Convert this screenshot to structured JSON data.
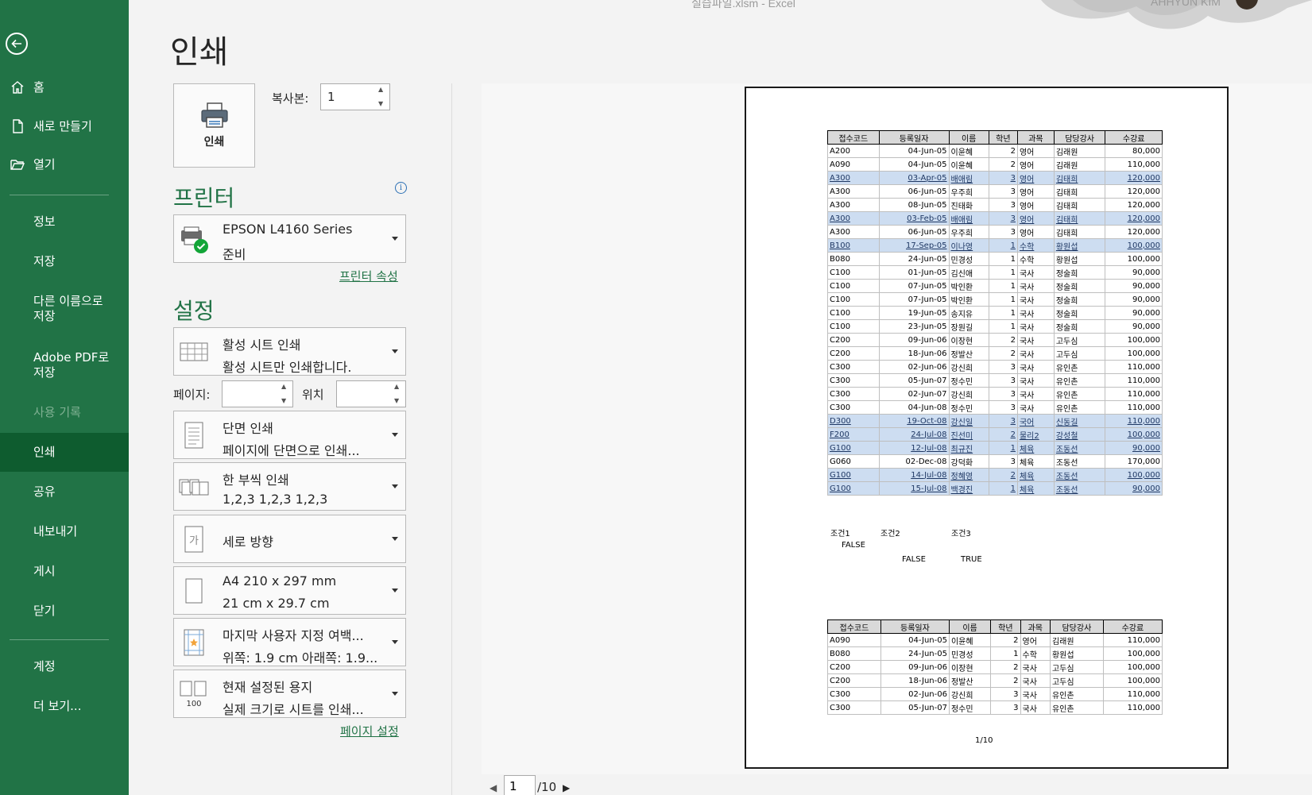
{
  "window": {
    "title": "실습파일.xlsm  -  Excel",
    "user": "AHHYUN KIM"
  },
  "sidebar": {
    "items": [
      {
        "label": "홈",
        "icon": "home-icon"
      },
      {
        "label": "새로 만들기",
        "icon": "new-document-icon"
      },
      {
        "label": "열기",
        "icon": "folder-open-icon"
      },
      {
        "label": "정보"
      },
      {
        "label": "저장"
      },
      {
        "label": "다른 이름으로\n저장"
      },
      {
        "label": "Adobe PDF로\n저장"
      },
      {
        "label": "사용 기록"
      },
      {
        "label": "인쇄"
      },
      {
        "label": "공유"
      },
      {
        "label": "내보내기"
      },
      {
        "label": "게시"
      },
      {
        "label": "닫기"
      },
      {
        "label": "계정"
      },
      {
        "label": "더 보기..."
      }
    ]
  },
  "page": {
    "title": "인쇄"
  },
  "print": {
    "button_label": "인쇄",
    "copies_label": "복사본:",
    "copies_value": "1"
  },
  "printer": {
    "section_title": "프린터",
    "name": "EPSON L4160 Series",
    "status": "준비",
    "properties_link": "프린터 속성"
  },
  "settings": {
    "section_title": "설정",
    "scope": {
      "line1": "활성 시트 인쇄",
      "line2": "활성 시트만 인쇄합니다."
    },
    "pages_label": "페이지:",
    "to_label": "위치",
    "sides": {
      "line1": "단면 인쇄",
      "line2": "페이지에 단면으로 인쇄..."
    },
    "collate": {
      "line1": "한 부씩 인쇄",
      "line2": "1,2,3     1,2,3     1,2,3"
    },
    "orientation": {
      "line1": "세로 방향"
    },
    "paper": {
      "line1": "A4 210 x 297 mm",
      "line2": "21 cm x 29.7 cm"
    },
    "margins": {
      "line1": "마지막 사용자 지정 여백...",
      "line2": "위쪽: 1.9 cm 아래쪽: 1.9..."
    },
    "scaling": {
      "line1": "현재 설정된 용지",
      "line2": "실제 크기로 시트를 인쇄..."
    },
    "page_setup_link": "페이지 설정"
  },
  "preview": {
    "headers": [
      "접수코드",
      "등록일자",
      "이름",
      "학년",
      "과목",
      "담당강사",
      "수강료"
    ],
    "rows": [
      [
        "A200",
        "04-Jun-05",
        "이윤혜",
        "2",
        "영어",
        "김래원",
        "80,000",
        false
      ],
      [
        "A090",
        "04-Jun-05",
        "이윤혜",
        "2",
        "영어",
        "김래원",
        "110,000",
        false
      ],
      [
        "A300",
        "03-Apr-05",
        "배애림",
        "3",
        "영어",
        "김태희",
        "120,000",
        true
      ],
      [
        "A300",
        "06-Jun-05",
        "우주희",
        "3",
        "영어",
        "김태희",
        "120,000",
        false
      ],
      [
        "A300",
        "08-Jun-05",
        "진태화",
        "3",
        "영어",
        "김태희",
        "120,000",
        false
      ],
      [
        "A300",
        "03-Feb-05",
        "배애림",
        "3",
        "영어",
        "김태희",
        "120,000",
        true
      ],
      [
        "A300",
        "06-Jun-05",
        "우주희",
        "3",
        "영어",
        "김태희",
        "120,000",
        false
      ],
      [
        "B100",
        "17-Sep-05",
        "이나영",
        "1",
        "수학",
        "황원섭",
        "100,000",
        true
      ],
      [
        "B080",
        "24-Jun-05",
        "민경성",
        "1",
        "수학",
        "황원섭",
        "100,000",
        false
      ],
      [
        "C100",
        "01-Jun-05",
        "김신애",
        "1",
        "국사",
        "정술희",
        "90,000",
        false
      ],
      [
        "C100",
        "07-Jun-05",
        "박인환",
        "1",
        "국사",
        "정술희",
        "90,000",
        false
      ],
      [
        "C100",
        "07-Jun-05",
        "박인환",
        "1",
        "국사",
        "정술희",
        "90,000",
        false
      ],
      [
        "C100",
        "19-Jun-05",
        "송지유",
        "1",
        "국사",
        "정술희",
        "90,000",
        false
      ],
      [
        "C100",
        "23-Jun-05",
        "장원길",
        "1",
        "국사",
        "정술희",
        "90,000",
        false
      ],
      [
        "C200",
        "09-Jun-06",
        "이장현",
        "2",
        "국사",
        "고두심",
        "100,000",
        false
      ],
      [
        "C200",
        "18-Jun-06",
        "정발산",
        "2",
        "국사",
        "고두심",
        "100,000",
        false
      ],
      [
        "C300",
        "02-Jun-06",
        "강신희",
        "3",
        "국사",
        "유인촌",
        "110,000",
        false
      ],
      [
        "C300",
        "05-Jun-07",
        "정수민",
        "3",
        "국사",
        "유인촌",
        "110,000",
        false
      ],
      [
        "C300",
        "02-Jun-07",
        "강신희",
        "3",
        "국사",
        "유인촌",
        "110,000",
        false
      ],
      [
        "C300",
        "04-Jun-08",
        "정수민",
        "3",
        "국사",
        "유인촌",
        "110,000",
        false
      ],
      [
        "D300",
        "19-Oct-08",
        "강신일",
        "3",
        "국어",
        "신동길",
        "110,000",
        true
      ],
      [
        "F200",
        "24-Jul-08",
        "진선미",
        "2",
        "물리2",
        "강성철",
        "100,000",
        true
      ],
      [
        "G100",
        "12-Jul-08",
        "최규진",
        "1",
        "체육",
        "조동선",
        "90,000",
        true
      ],
      [
        "G060",
        "02-Dec-08",
        "강덕화",
        "3",
        "체육",
        "조동선",
        "170,000",
        false
      ],
      [
        "G100",
        "14-Jul-08",
        "정혜영",
        "2",
        "체육",
        "조동선",
        "100,000",
        true
      ],
      [
        "G100",
        "15-Jul-08",
        "백경진",
        "1",
        "체육",
        "조동선",
        "90,000",
        true
      ]
    ],
    "conditions": {
      "labels": [
        "조건1",
        "조건2",
        "조건3"
      ],
      "values": [
        "FALSE",
        "FALSE",
        "TRUE"
      ]
    },
    "rows2": [
      [
        "A090",
        "04-Jun-05",
        "이윤혜",
        "2",
        "영어",
        "김래원",
        "110,000",
        false
      ],
      [
        "B080",
        "24-Jun-05",
        "민경성",
        "1",
        "수학",
        "황원섭",
        "100,000",
        false
      ],
      [
        "C200",
        "09-Jun-06",
        "이장현",
        "2",
        "국사",
        "고두심",
        "100,000",
        false
      ],
      [
        "C200",
        "18-Jun-06",
        "정발산",
        "2",
        "국사",
        "고두심",
        "100,000",
        false
      ],
      [
        "C300",
        "02-Jun-06",
        "강신희",
        "3",
        "국사",
        "유인촌",
        "110,000",
        false
      ],
      [
        "C300",
        "05-Jun-07",
        "정수민",
        "3",
        "국사",
        "유인촌",
        "110,000",
        false
      ]
    ],
    "page_indicator": "1/10"
  },
  "pager": {
    "current": "1",
    "total": "/10"
  },
  "colors": {
    "sidebar": "#217346",
    "sidebar_active": "#0e5c2f",
    "accent": "#217346",
    "highlight_row": "#cdddf1"
  }
}
